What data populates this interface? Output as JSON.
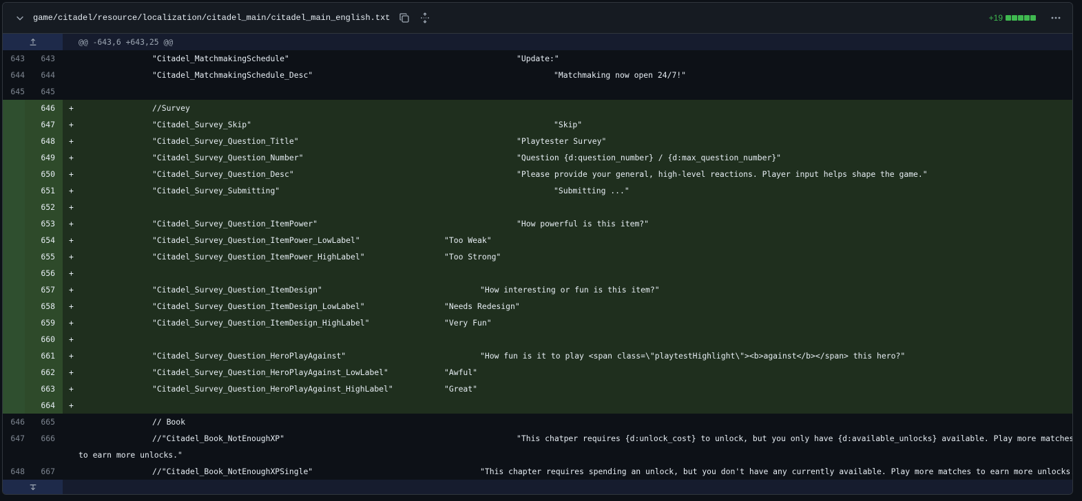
{
  "file": {
    "path": "game/citadel/resource/localization/citadel_main/citadel_main_english.txt",
    "additions": "+19"
  },
  "icons": {
    "collapse": "chevron-down-icon",
    "copy": "copy-icon",
    "expand_all": "unfold-icon",
    "more": "kebab-horizontal-icon",
    "expand_up": "expand-up-icon",
    "expand_down": "expand-down-icon"
  },
  "hunk": {
    "header": "@@ -643,6 +643,25 @@"
  },
  "lines": [
    {
      "old": "643",
      "new": "643",
      "sign": "",
      "key": "\"Citadel_MatchmakingSchedule\"",
      "val": "\"Update:\"",
      "type": "ctx"
    },
    {
      "old": "644",
      "new": "644",
      "sign": "",
      "key": "\"Citadel_MatchmakingSchedule_Desc\"",
      "val": "\"Matchmaking now open 24/7!\"",
      "type": "ctx"
    },
    {
      "old": "645",
      "new": "645",
      "sign": "",
      "key": "",
      "val": "",
      "type": "ctx"
    },
    {
      "old": "",
      "new": "646",
      "sign": "+",
      "key": "//Survey",
      "val": "",
      "type": "add"
    },
    {
      "old": "",
      "new": "647",
      "sign": "+",
      "key": "\"Citadel_Survey_Skip\"",
      "val": "\"Skip\"",
      "type": "add"
    },
    {
      "old": "",
      "new": "648",
      "sign": "+",
      "key": "\"Citadel_Survey_Question_Title\"",
      "val": "\"Playtester Survey\"",
      "type": "add"
    },
    {
      "old": "",
      "new": "649",
      "sign": "+",
      "key": "\"Citadel_Survey_Question_Number\"",
      "val": "\"Question {d:question_number} / {d:max_question_number}\"",
      "type": "add"
    },
    {
      "old": "",
      "new": "650",
      "sign": "+",
      "key": "\"Citadel_Survey_Question_Desc\"",
      "val": "\"Please provide your general, high-level reactions. Player input helps shape the game.\"",
      "type": "add"
    },
    {
      "old": "",
      "new": "651",
      "sign": "+",
      "key": "\"Citadel_Survey_Submitting\"",
      "val": "\"Submitting ...\"",
      "type": "add"
    },
    {
      "old": "",
      "new": "652",
      "sign": "+",
      "key": "",
      "val": "",
      "type": "add"
    },
    {
      "old": "",
      "new": "653",
      "sign": "+",
      "key": "\"Citadel_Survey_Question_ItemPower\"",
      "val": "\"How powerful is this item?\"",
      "type": "add"
    },
    {
      "old": "",
      "new": "654",
      "sign": "+",
      "key": "\"Citadel_Survey_Question_ItemPower_LowLabel\"",
      "val": "\"Too Weak\"",
      "type": "add"
    },
    {
      "old": "",
      "new": "655",
      "sign": "+",
      "key": "\"Citadel_Survey_Question_ItemPower_HighLabel\"",
      "val": "\"Too Strong\"",
      "type": "add"
    },
    {
      "old": "",
      "new": "656",
      "sign": "+",
      "key": "",
      "val": "",
      "type": "add"
    },
    {
      "old": "",
      "new": "657",
      "sign": "+",
      "key": "\"Citadel_Survey_Question_ItemDesign\"",
      "val": "\"How interesting or fun is this item?\"",
      "type": "add"
    },
    {
      "old": "",
      "new": "658",
      "sign": "+",
      "key": "\"Citadel_Survey_Question_ItemDesign_LowLabel\"",
      "val": "\"Needs Redesign\"",
      "type": "add"
    },
    {
      "old": "",
      "new": "659",
      "sign": "+",
      "key": "\"Citadel_Survey_Question_ItemDesign_HighLabel\"",
      "val": "\"Very Fun\"",
      "type": "add"
    },
    {
      "old": "",
      "new": "660",
      "sign": "+",
      "key": "",
      "val": "",
      "type": "add"
    },
    {
      "old": "",
      "new": "661",
      "sign": "+",
      "key": "\"Citadel_Survey_Question_HeroPlayAgainst\"",
      "val": "\"How fun is it to play <span class=\\\"playtestHighlight\\\"><b>against</b></span> this hero?\"",
      "type": "add"
    },
    {
      "old": "",
      "new": "662",
      "sign": "+",
      "key": "\"Citadel_Survey_Question_HeroPlayAgainst_LowLabel\"",
      "val": "\"Awful\"",
      "type": "add"
    },
    {
      "old": "",
      "new": "663",
      "sign": "+",
      "key": "\"Citadel_Survey_Question_HeroPlayAgainst_HighLabel\"",
      "val": "\"Great\"",
      "type": "add"
    },
    {
      "old": "",
      "new": "664",
      "sign": "+",
      "key": "",
      "val": "",
      "type": "add"
    },
    {
      "old": "646",
      "new": "665",
      "sign": "",
      "key": "// Book",
      "val": "",
      "type": "ctx"
    },
    {
      "old": "647",
      "new": "666",
      "sign": "",
      "key": "//\"Citadel_Book_NotEnoughXP\"",
      "val": "\"This chatper requires {d:unlock_cost} to unlock, but you only have {d:available_unlocks} available. Play more matches",
      "val2": "to earn more unlocks.\"",
      "type": "ctx"
    },
    {
      "old": "648",
      "new": "667",
      "sign": "",
      "key": "//\"Citadel_Book_NotEnoughXPSingle\"",
      "val": "\"This chapter requires spending an unlock, but you don't have any currently available. Play more matches to earn more unlocks.\"",
      "type": "ctx"
    }
  ]
}
